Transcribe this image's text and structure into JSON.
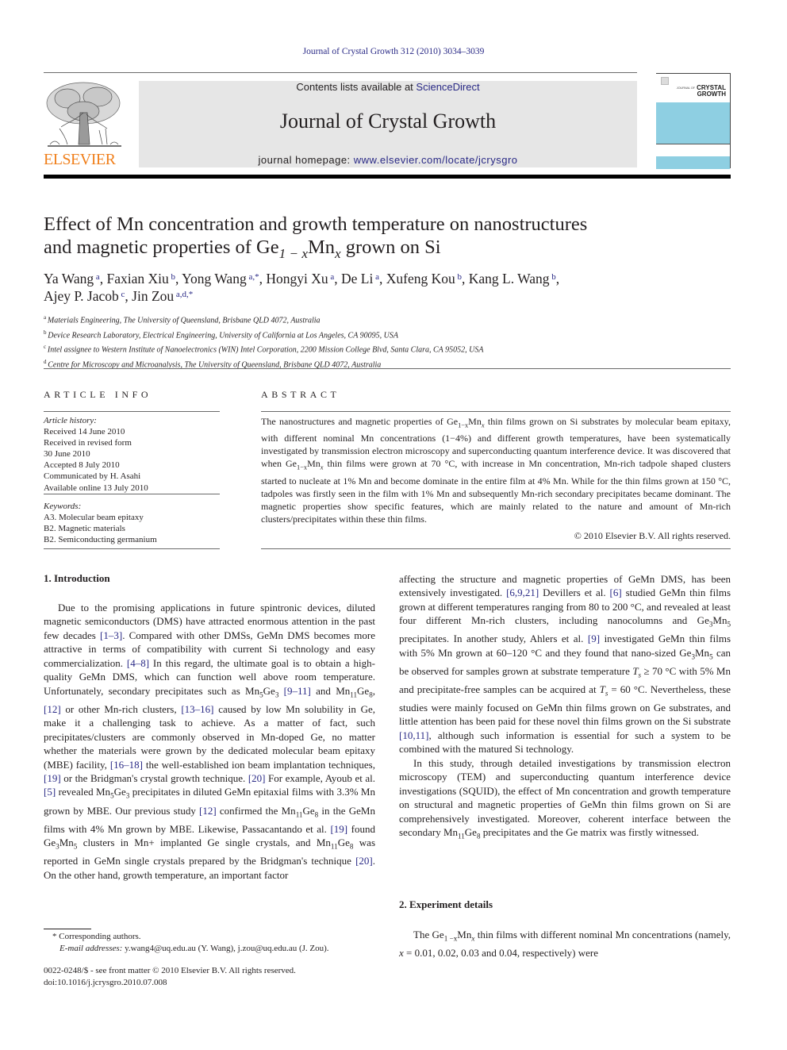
{
  "header": {
    "citation": "Journal of Crystal Growth 312 (2010) 3034–3039",
    "contents_prefix": "Contents lists available at ",
    "contents_link": "ScienceDirect",
    "journal_title": "Journal of Crystal Growth",
    "homepage_prefix": "journal homepage: ",
    "homepage_link": "www.elsevier.com/locate/jcrysgro",
    "publisher_logo_text": "ELSEVIER",
    "cover_small_text": "JOURNAL OF",
    "cover_line1": "CRYSTAL",
    "cover_line2": "GROWTH"
  },
  "article": {
    "title_line1": "Effect of Mn concentration and growth temperature on nanostructures",
    "title_line2_pre": "and magnetic properties of Ge",
    "title_sub1": "1 − x",
    "title_mid": "Mn",
    "title_sub2": "x",
    "title_post": " grown on Si",
    "authors": [
      {
        "name": "Ya Wang",
        "aff": "a"
      },
      {
        "name": "Faxian Xiu",
        "aff": "b"
      },
      {
        "name": "Yong Wang",
        "aff": "a,*"
      },
      {
        "name": "Hongyi Xu",
        "aff": "a"
      },
      {
        "name": "De Li",
        "aff": "a"
      },
      {
        "name": "Xufeng Kou",
        "aff": "b"
      },
      {
        "name": "Kang L. Wang",
        "aff": "b"
      },
      {
        "name": "Ajey P. Jacob",
        "aff": "c"
      },
      {
        "name": "Jin Zou",
        "aff": "a,d,*"
      }
    ],
    "affiliations": [
      {
        "key": "a",
        "text": "Materials Engineering, The University of Queensland, Brisbane QLD 4072, Australia"
      },
      {
        "key": "b",
        "text": "Device Research Laboratory, Electrical Engineering, University of California at Los Angeles, CA 90095, USA"
      },
      {
        "key": "c",
        "text": "Intel assignee to Western Institute of Nanoelectronics (WIN) Intel Corporation, 2200 Mission College Blvd, Santa Clara, CA 95052, USA"
      },
      {
        "key": "d",
        "text": "Centre for Microscopy and Microanalysis, The University of Queensland, Brisbane QLD 4072, Australia"
      }
    ]
  },
  "article_info": {
    "heading": "ARTICLE INFO",
    "history_label": "Article history:",
    "history": [
      "Received 14 June 2010",
      "Received in revised form",
      "30 June 2010",
      "Accepted 8 July 2010",
      "Communicated by H. Asahi",
      "Available online 13 July 2010"
    ],
    "keywords_label": "Keywords:",
    "keywords": [
      "A3. Molecular beam epitaxy",
      "B2. Magnetic materials",
      "B2. Semiconducting germanium"
    ]
  },
  "abstract": {
    "heading": "ABSTRACT",
    "p1": "The nanostructures and magnetic properties of Ge",
    "p1_sub1": "1−x",
    "p1_mn": "Mn",
    "p1_sub2": "x",
    "p2": " thin films grown on Si substrates by molecular beam epitaxy, with different nominal Mn concentrations (1−4%) and different growth temperatures, have been systematically investigated by transmission electron microscopy and superconducting quantum interference device. It was discovered that when Ge",
    "p3": " thin films were grown at 70 °C, with increase in Mn concentration, Mn-rich tadpole shaped clusters started to nucleate at 1% Mn and become dominate in the entire film at 4% Mn. While for the thin films grown at 150 °C, tadpoles was firstly seen in the film with 1% Mn and subsequently Mn-rich secondary precipitates became dominant. The magnetic properties show specific features, which are mainly related to the nature and amount of Mn-rich clusters/precipitates within these thin films.",
    "copyright": "© 2010 Elsevier B.V. All rights reserved."
  },
  "sections": {
    "intro_heading": "1.  Introduction",
    "exp_heading": "2.  Experiment details"
  },
  "body": {
    "l1": "Due to the promising applications in future spintronic devices, diluted magnetic semiconductors (DMS) have attracted enormous attention in the past few decades ",
    "r1_3": "[1–3]",
    "l2": ". Compared with other DMSs, GeMn DMS becomes more attractive in terms of compatibility with current Si technology and easy commercialization. ",
    "r4_8": "[4–8]",
    "l3": " In this regard, the ultimate goal is to obtain a high-quality GeMn DMS, which can function well above room temperature. Unfortunately, secondary precipitates such as Mn",
    "l3b": "Ge",
    "r9_11": "[9–11]",
    "l4": " and Mn",
    "l4b": "Ge",
    "r12": "[12]",
    "l5": " or other Mn-rich clusters, ",
    "r13_16": "[13–16]",
    "l6": " caused by low Mn solubility in Ge, make it a challenging task to achieve. As a matter of fact, such precipitates/clusters are commonly observed in Mn-doped Ge, no matter whether the materials were grown by the dedicated molecular beam epitaxy (MBE) facility, ",
    "r16_18": "[16–18]",
    "l7": " the well-established ion beam implantation techniques, ",
    "r19": "[19]",
    "l8": " or the Bridgman's crystal growth technique. ",
    "r20": "[20]",
    "l9": " For example, Ayoub et al. ",
    "r5": "[5]",
    "l10": " revealed Mn",
    "l10b": "Ge",
    "l10c": " precipitates in diluted GeMn epitaxial films with 3.3% Mn grown by MBE. Our previous study ",
    "l11": " confirmed the Mn",
    "l11b": "Ge",
    "l11c": " in the GeMn films with 4% Mn grown by MBE. Likewise, Passacantando et al. ",
    "l12": " found Ge",
    "l12b": "Mn",
    "l12c": " clusters in Mn+ implanted Ge single crystals, and Mn",
    "l12d": "Ge",
    "l12e": " was reported in GeMn single crystals prepared by the Bridgman's technique ",
    "l13": ". On the other hand, growth temperature, an important factor",
    "rr1": "affecting the structure and magnetic properties of GeMn DMS, has been extensively investigated. ",
    "r6_9_21": "[6,9,21]",
    "rr2": " Devillers et al. ",
    "r6": "[6]",
    "rr3": " studied GeMn thin films grown at different temperatures ranging from 80 to 200 °C, and revealed at least four different Mn-rich clusters, including nanocolumns and Ge",
    "rr3b": "Mn",
    "rr3c": " precipitates. In another study, Ahlers et al. ",
    "r9": "[9]",
    "rr4": " investigated GeMn thin films with 5% Mn grown at 60–120 °C and they found that nano-sized Ge",
    "rr4b": "Mn",
    "rr4c": " can be observed for samples grown at substrate temperature ",
    "ts": "T",
    "ts_sub": "s",
    "rr5": " ≥ 70 °C with 5% Mn and precipitate-free samples can be acquired at ",
    "rr6": " = 60 °C. Nevertheless, these studies were mainly focused on GeMn thin films grown on Ge substrates, and little attention has been paid for these novel thin films grown on the Si substrate ",
    "r10_11": "[10,11]",
    "rr7": ", although such information is essential for such a system to be combined with the matured Si technology.",
    "rr8": "In this study, through detailed investigations by transmission electron microscopy (TEM) and superconducting quantum interference device investigations (SQUID), the effect of Mn concentration and growth temperature on structural and magnetic properties of GeMn thin films grown on Si are comprehensively investigated. Moreover, coherent interface between the secondary Mn",
    "rr8b": "Ge",
    "rr8c": " precipitates and the Ge matrix was firstly witnessed.",
    "e1": "The Ge",
    "e1_sub1": "1 −x",
    "e1_mn": "Mn",
    "e1_sub2": "x",
    "e2": " thin films with different nominal Mn concentrations (namely, ",
    "e_x": "x",
    "e3": " = 0.01, 0.02, 0.03 and 0.04, respectively) were",
    "sub5": "5",
    "sub3": "3",
    "sub11": "11",
    "sub8": "8"
  },
  "footnotes": {
    "corresponding": "* Corresponding authors.",
    "email_label": "E-mail addresses:",
    "emails": " y.wang4@uq.edu.au (Y. Wang), j.zou@uq.edu.au (J. Zou).",
    "front_matter": "0022-0248/$ - see front matter © 2010 Elsevier B.V. All rights reserved.",
    "doi": "doi:10.1016/j.jcrysgro.2010.07.008"
  }
}
